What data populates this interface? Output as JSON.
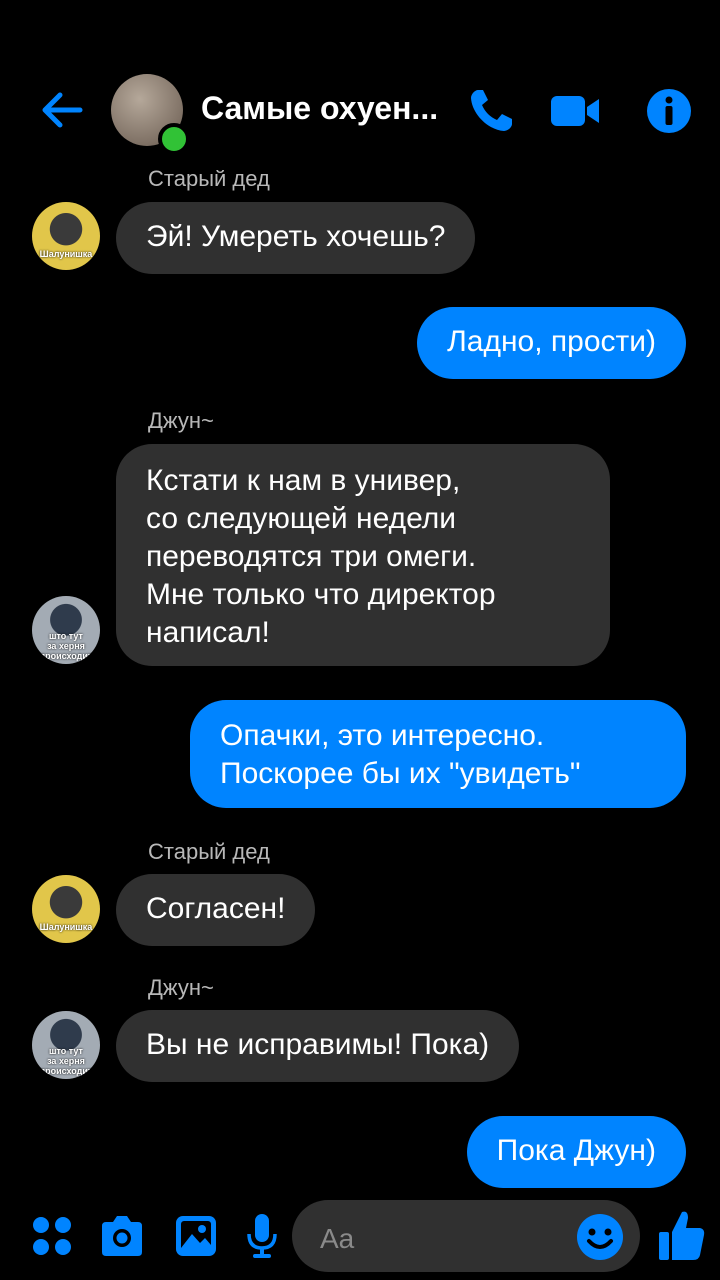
{
  "header": {
    "title": "Самые охуен...",
    "back_icon": "arrow-left-icon",
    "call_icon": "phone-icon",
    "video_icon": "video-camera-icon",
    "info_icon": "info-icon",
    "accent_color": "#0084ff",
    "online_color": "#31c236"
  },
  "messages": [
    {
      "sender": "Старый дед",
      "text": [
        "Эй! Умереть хочешь?"
      ],
      "direction": "in"
    },
    {
      "text": [
        "Ладно, прости)"
      ],
      "direction": "out"
    },
    {
      "sender": "Джун~",
      "text": [
        "Кстати к нам в универ,",
        "со следующей недели",
        "переводятся три омеги.",
        "Мне только что директор",
        "написал!"
      ],
      "direction": "in"
    },
    {
      "text": [
        "Опачки, это интересно.",
        "Поскорее бы их \"увидеть\""
      ],
      "direction": "out"
    },
    {
      "sender": "Старый дед",
      "text": [
        "Согласен!"
      ],
      "direction": "in"
    },
    {
      "sender": "Джун~",
      "text": [
        "Вы не исправимы! Пока)"
      ],
      "direction": "in"
    },
    {
      "text": [
        "Пока Джун)"
      ],
      "direction": "out"
    }
  ],
  "avatars": {
    "old_caption": "Шалунишка",
    "jun_caption": [
      "што тут",
      "за херня",
      "происходит"
    ]
  },
  "composer": {
    "placeholder": "Aa",
    "icons": [
      "apps-grid-icon",
      "camera-icon",
      "image-icon",
      "microphone-icon",
      "emoji-icon",
      "thumbs-up-icon"
    ]
  }
}
